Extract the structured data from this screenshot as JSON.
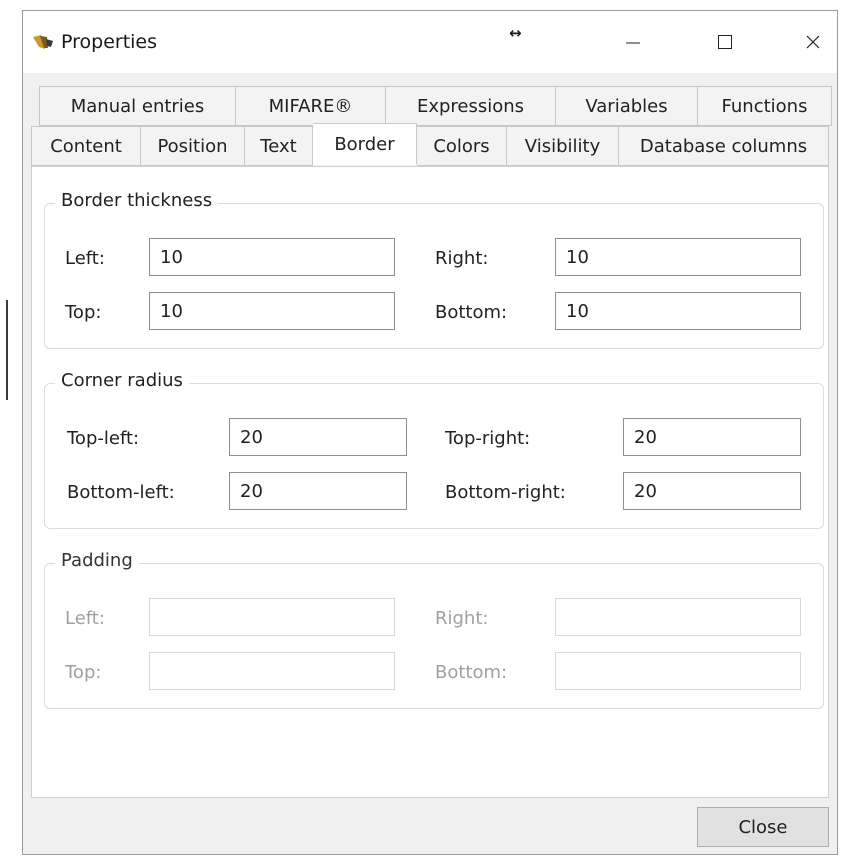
{
  "window": {
    "title": "Properties",
    "resize_glyph": "↔"
  },
  "tabs": {
    "row1": [
      "Manual entries",
      "MIFARE®",
      "Expressions",
      "Variables",
      "Functions"
    ],
    "row2": [
      "Content",
      "Position",
      "Text",
      "Border",
      "Colors",
      "Visibility",
      "Database columns"
    ],
    "active": "Border"
  },
  "border_thickness": {
    "legend": "Border thickness",
    "left_label": "Left:",
    "left_value": "10",
    "right_label": "Right:",
    "right_value": "10",
    "top_label": "Top:",
    "top_value": "10",
    "bottom_label": "Bottom:",
    "bottom_value": "10"
  },
  "corner_radius": {
    "legend": "Corner radius",
    "top_left_label": "Top-left:",
    "top_left_value": "20",
    "top_right_label": "Top-right:",
    "top_right_value": "20",
    "bottom_left_label": "Bottom-left:",
    "bottom_left_value": "20",
    "bottom_right_label": "Bottom-right:",
    "bottom_right_value": "20"
  },
  "padding": {
    "legend": "Padding",
    "left_label": "Left:",
    "left_value": "",
    "right_label": "Right:",
    "right_value": "",
    "top_label": "Top:",
    "top_value": "",
    "bottom_label": "Bottom:",
    "bottom_value": ""
  },
  "buttons": {
    "close": "Close"
  },
  "icons": {
    "app": "app-logo-icon",
    "minimize": "minimize-icon",
    "maximize": "maximize-icon",
    "close": "close-icon"
  },
  "colors": {
    "window_bg": "#f0f0f0",
    "content_bg": "#ffffff",
    "disabled_text": "#a0a0a0"
  }
}
